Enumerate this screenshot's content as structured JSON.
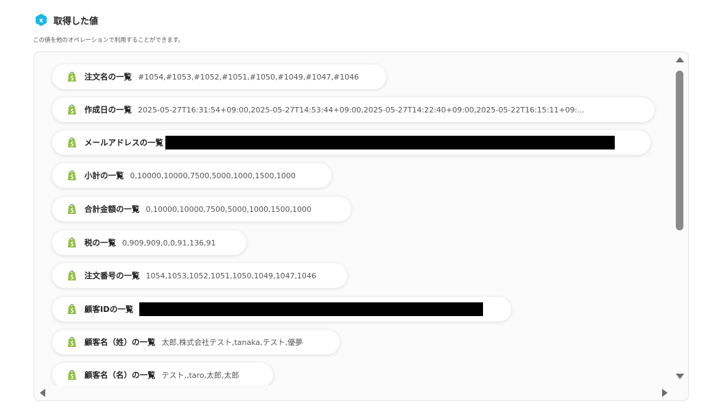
{
  "header": {
    "icon": "yoom-x-hex-icon",
    "accent_color": "#18b8e0",
    "title": "取得した値",
    "subtitle": "この値を他のオペレーションで利用することができます。"
  },
  "items": [
    {
      "label": "注文名の一覧",
      "value": "#1054,#1053,#1052,#1051,#1050,#1049,#1047,#1046",
      "icon": "shopify-icon"
    },
    {
      "label": "作成日の一覧",
      "value": "2025-05-27T16:31:54+09:00,2025-05-27T14:53:44+09:00,2025-05-27T14:22:40+09:00,2025-05-22T16:15:11+09:...",
      "icon": "shopify-icon"
    },
    {
      "label": "メールアドレスの一覧",
      "value": "",
      "redacted": true,
      "icon": "shopify-icon"
    },
    {
      "label": "小計の一覧",
      "value": "0,10000,10000,7500,5000,1000,1500,1000",
      "icon": "shopify-icon"
    },
    {
      "label": "合計金額の一覧",
      "value": "0,10000,10000,7500,5000,1000,1500,1000",
      "icon": "shopify-icon"
    },
    {
      "label": "税の一覧",
      "value": "0,909,909,0,0,91,136,91",
      "icon": "shopify-icon"
    },
    {
      "label": "注文番号の一覧",
      "value": "1054,1053,1052,1051,1050,1049,1047,1046",
      "icon": "shopify-icon"
    },
    {
      "label": "顧客IDの一覧",
      "value": "",
      "redacted": true,
      "icon": "shopify-icon"
    },
    {
      "label": "顧客名（姓）の一覧",
      "value": "太郎,株式会社テスト,tanaka,テスト,優夢",
      "icon": "shopify-icon"
    },
    {
      "label": "顧客名（名）の一覧",
      "value": "テスト,,taro,太郎,太郎",
      "icon": "shopify-icon"
    }
  ],
  "colors": {
    "shopify_green": "#95bf47",
    "shopify_dark": "#5e8e3e",
    "redaction": "#000000"
  }
}
